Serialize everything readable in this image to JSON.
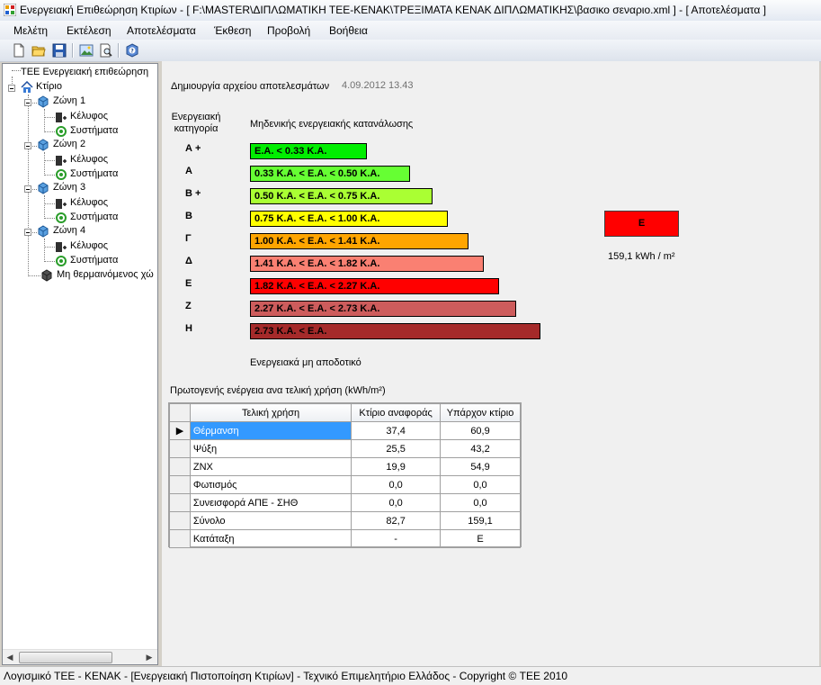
{
  "window": {
    "title": "Ενεργειακή Επιθεώρηση Κτιρίων - [ F:\\MASTER\\ΔΙΠΛΩΜΑΤΙΚΗ ΤΕΕ-ΚΕΝΑΚ\\ΤΡΕΞΙΜΑΤΑ ΚΕΝΑΚ ΔΙΠΛΩΜΑΤΙΚΗΣ\\βασικο σεναριο.xml ] - [ Αποτελέσματα ]"
  },
  "menu": {
    "items": [
      "Μελέτη",
      "Εκτέλεση",
      "Αποτελέσματα",
      "Έκθεση",
      "Προβολή",
      "Βοήθεια"
    ]
  },
  "toolbar": {
    "icons": [
      "new-file-icon",
      "open-folder-icon",
      "save-icon",
      "image-icon",
      "print-preview-icon",
      "help-icon"
    ]
  },
  "tree": {
    "root": "ΤΕΕ Ενεργειακή επιθεώρηση",
    "building": "Κτίριο",
    "zones": [
      {
        "label": "Ζώνη 1",
        "children": [
          "Κέλυφος",
          "Συστήματα"
        ]
      },
      {
        "label": "Ζώνη 2",
        "children": [
          "Κέλυφος",
          "Συστήματα"
        ]
      },
      {
        "label": "Ζώνη 3",
        "children": [
          "Κέλυφος",
          "Συστήματα"
        ]
      },
      {
        "label": "Ζώνη 4",
        "children": [
          "Κέλυφος",
          "Συστήματα"
        ]
      }
    ],
    "unheated": "Μη θερμαινόμενος χώ"
  },
  "results": {
    "file_created_label": "Δημιουργία αρχείου αποτελεσμάτων",
    "file_created_date": "4.09.2012 13.43",
    "category_header": "Ενεργειακή\nκατηγορία",
    "top_caption": "Μηδενικής ενεργειακής κατανάλωσης",
    "bottom_caption": "Ενεργειακά μη αποδοτικό",
    "grades": [
      {
        "label": "Α +",
        "text": "Ε.Α. < 0.33 Κ.Α.",
        "color": "#00ee00"
      },
      {
        "label": "Α",
        "text": "0.33 Κ.Α. <  Ε.Α. < 0.50 Κ.Α.",
        "color": "#66ff33"
      },
      {
        "label": "Β +",
        "text": "0.50 Κ.Α. <  Ε.Α. < 0.75 Κ.Α.",
        "color": "#aaff33"
      },
      {
        "label": "Β",
        "text": "0.75 Κ.Α. <  Ε.Α. < 1.00 Κ.Α.",
        "color": "#ffff00"
      },
      {
        "label": "Γ",
        "text": "1.00 Κ.Α. <  Ε.Α. < 1.41 Κ.Α.",
        "color": "#ffa500"
      },
      {
        "label": "Δ",
        "text": "1.41 Κ.Α. <  Ε.Α. < 1.82 Κ.Α.",
        "color": "#fa8072"
      },
      {
        "label": "Ε",
        "text": "1.82 Κ.Α. <  Ε.Α. < 2.27 Κ.Α.",
        "color": "#ff0000"
      },
      {
        "label": "Ζ",
        "text": "2.27 Κ.Α. <  Ε.Α. < 2.73 Κ.Α.",
        "color": "#cd5c5c"
      },
      {
        "label": "Η",
        "text": "2.73 Κ.Α. <  Ε.Α.",
        "color": "#a52a2a"
      }
    ],
    "result_grade": "Ε",
    "result_color": "#ff0000",
    "result_value": "159,1 kWh / m²"
  },
  "primary_energy": {
    "title": "Πρωτογενής ενέργεια ανα τελική χρήση (kWh/m²)",
    "columns": [
      "Τελική χρήση",
      "Κτίριο αναφοράς",
      "Υπάρχον κτίριο"
    ],
    "rows": [
      [
        "Θέρμανση",
        "37,4",
        "60,9"
      ],
      [
        "Ψύξη",
        "25,5",
        "43,2"
      ],
      [
        "ΖΝΧ",
        "19,9",
        "54,9"
      ],
      [
        "Φωτισμός",
        "0,0",
        "0,0"
      ],
      [
        "Συνεισφορά ΑΠΕ - ΣΗΘ",
        "0,0",
        "0,0"
      ],
      [
        "Σύνολο",
        "82,7",
        "159,1"
      ],
      [
        "Κατάταξη",
        "-",
        "Ε"
      ]
    ],
    "selected_row": 0
  },
  "statusbar": {
    "text": "Λογισμικό ΤΕΕ - ΚΕΝΑΚ  -  [Ενεργειακή Πιστοποίηση Κτιρίων]  -  Τεχνικό Επιμελητήριο Ελλάδος  -  Copyright © ΤΕΕ 2010"
  }
}
